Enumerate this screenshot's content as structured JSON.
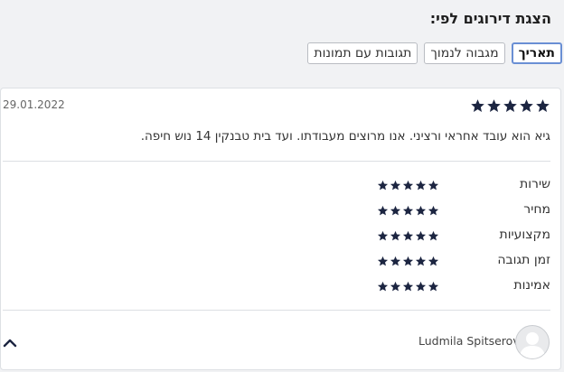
{
  "sort": {
    "title": "הצגת דירוגים לפי:",
    "options": [
      {
        "label": "תאריך",
        "active": true
      },
      {
        "label": "מגבוה לנמוך",
        "active": false
      },
      {
        "label": "תגובות עם תמונות",
        "active": false
      }
    ]
  },
  "review": {
    "overall_rating": 5,
    "date": "29.01.2022",
    "text": "גיא הוא עובד אחראי ורציני. אנו מרוצים מעבודתו. ועד בית טבנקין 14 נוש חיפה.",
    "categories": [
      {
        "label": "שירות",
        "rating": 5
      },
      {
        "label": "מחיר",
        "rating": 5
      },
      {
        "label": "מקצועיות",
        "rating": 5
      },
      {
        "label": "זמן תגובה",
        "rating": 5
      },
      {
        "label": "אמינות",
        "rating": 5
      }
    ],
    "reviewer_name": "Ludmila Spitserov"
  },
  "colors": {
    "star": "#1c2541",
    "active_border": "#6a8fd4"
  }
}
